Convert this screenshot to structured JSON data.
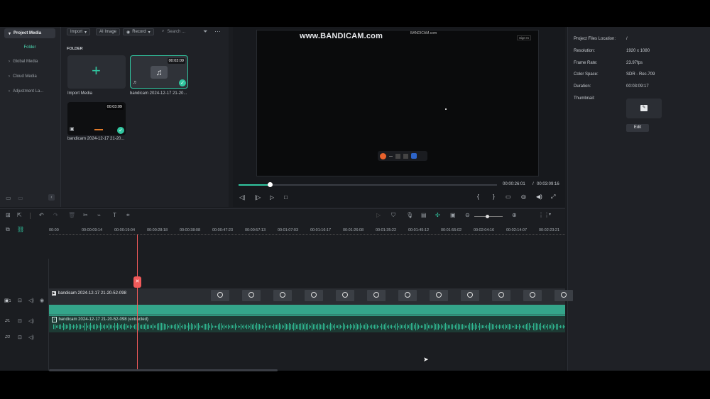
{
  "sidebar": {
    "items": [
      {
        "label": "Project Media",
        "active": true
      },
      {
        "label": "Folder",
        "sub": true
      },
      {
        "label": "Global Media"
      },
      {
        "label": "Cloud Media"
      },
      {
        "label": "Adjustment La..."
      }
    ]
  },
  "media_toolbar": {
    "import_label": "Import",
    "ai_image_label": "AI Image",
    "record_label": "Record",
    "search_placeholder": "Search ..."
  },
  "media": {
    "folder_heading": "FOLDER",
    "import_label": "Import Media",
    "items": [
      {
        "name": "bandicam 2024-12-17 21-20...",
        "duration": "00:03:09",
        "type": "audio"
      },
      {
        "name": "bandicam 2024-12-17 21-20...",
        "duration": "00:03:09",
        "type": "video"
      }
    ]
  },
  "player": {
    "watermark": "www.BANDICAM.com",
    "watermark_small": "BANDICAM.com",
    "sign_in": "Sign In",
    "current_time": "00:00:26:01",
    "separator": "/",
    "total_time": "00:03:09:16",
    "progress": 0.12
  },
  "properties": {
    "rows": [
      {
        "label": "Project Files Location:",
        "value": "/"
      },
      {
        "label": "Resolution:",
        "value": "1920 x 1080"
      },
      {
        "label": "Frame Rate:",
        "value": "23.97fps"
      },
      {
        "label": "Color Space:",
        "value": "SDR - Rec.709"
      },
      {
        "label": "Duration:",
        "value": "00:03:09:17"
      }
    ],
    "thumbnail_label": "Thumbnail:",
    "edit_label": "Edit"
  },
  "timeline": {
    "ruler": [
      "00:00",
      "00:00:09:14",
      "00:00:19:04",
      "00:00:28:18",
      "00:00:38:08",
      "00:00:47:23",
      "00:00:57:13",
      "00:01:07:03",
      "00:01:16:17",
      "00:01:26:08",
      "00:01:35:22",
      "00:01:45:12",
      "00:01:55:02",
      "00:02:04:16",
      "00:02:14:07",
      "00:02:23:21"
    ],
    "video_clip": "bandicam 2024-12-17 21-20-52-098",
    "audio_clip": "bandicam 2024-12-17 21-20-52-098 (extracted)",
    "tracks": [
      {
        "num": "1",
        "type": "video"
      },
      {
        "num": "1",
        "type": "audio"
      },
      {
        "num": "2",
        "type": "audio"
      }
    ]
  },
  "colors": {
    "accent": "#31c6a0",
    "playhead": "#f05a5a",
    "video_track": "#34a58a",
    "audio_wave": "#2fb891"
  }
}
